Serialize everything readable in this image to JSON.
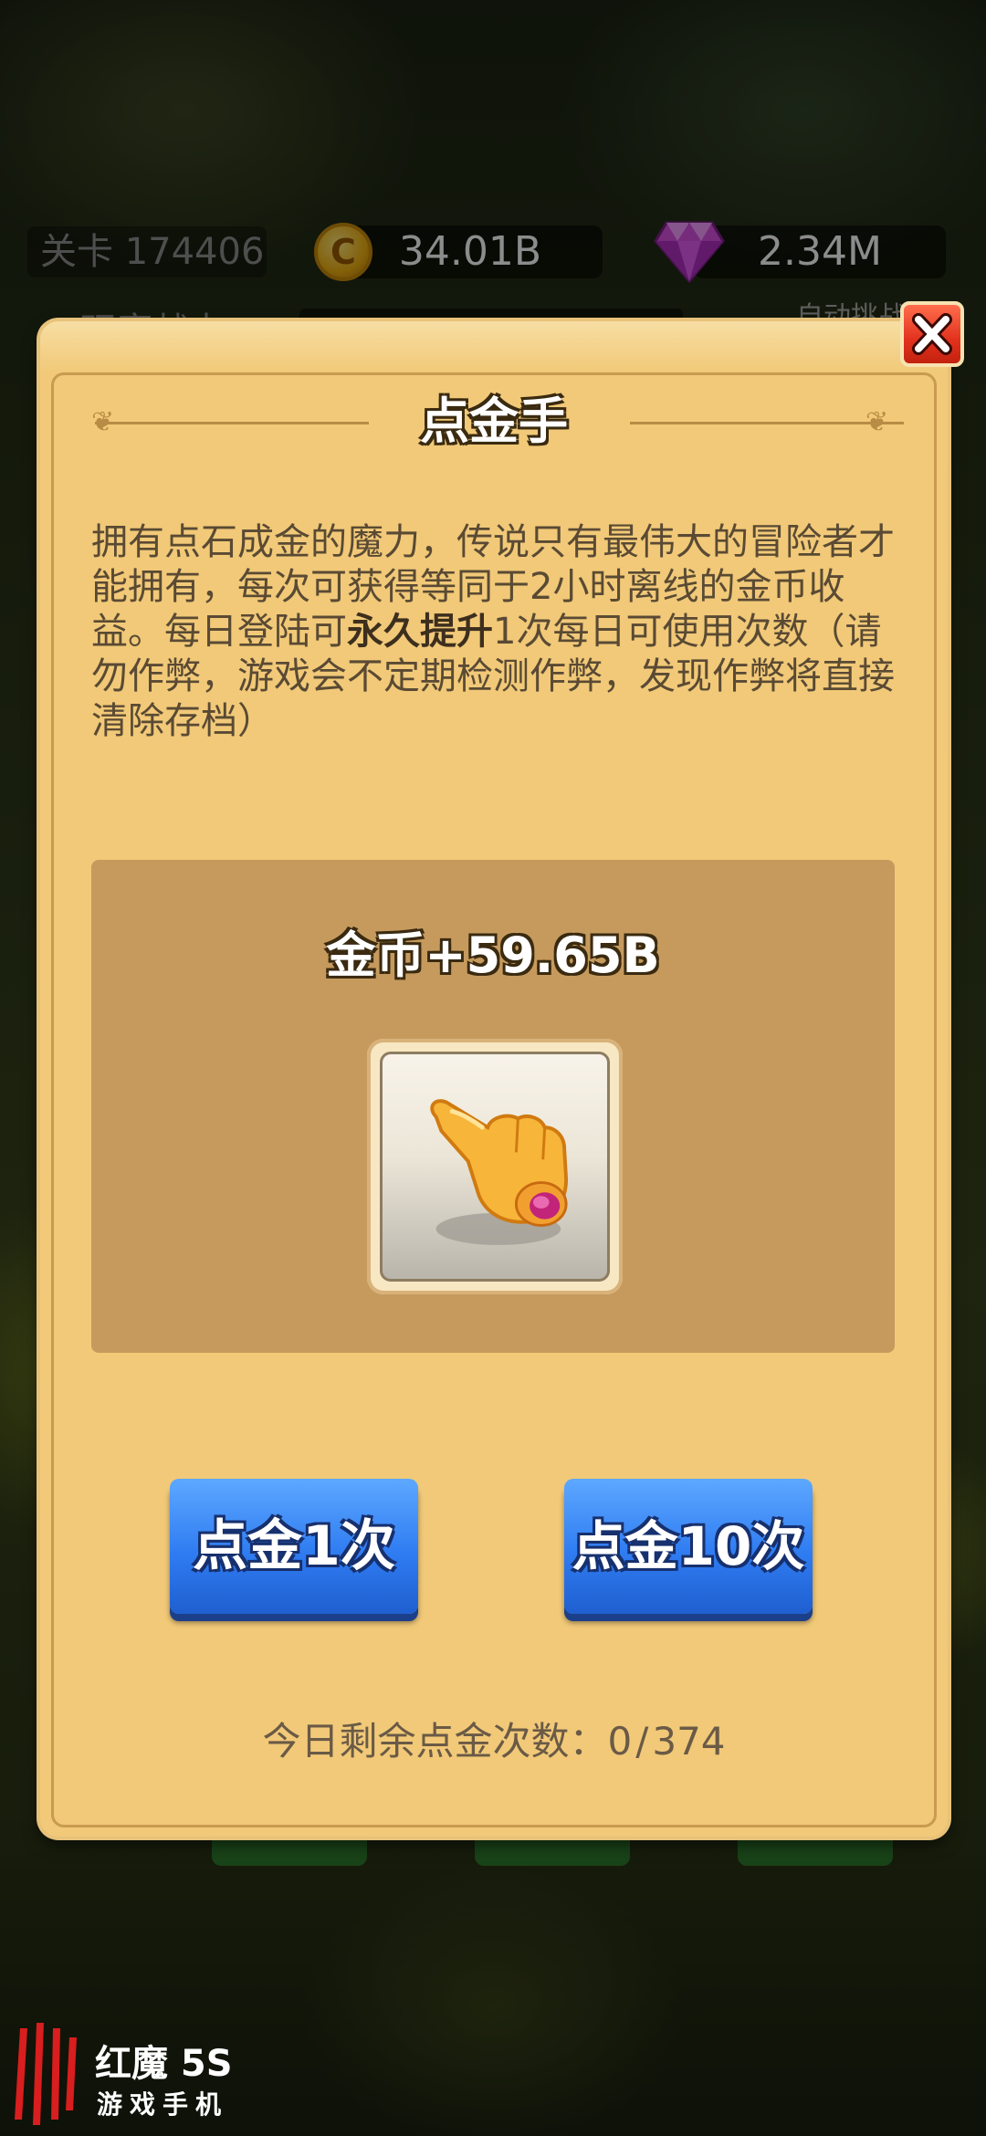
{
  "hud": {
    "stage_label": "关卡 174406",
    "coins": "34.01B",
    "gems": "2.34M",
    "power_label": "玩家战力",
    "auto_label": "自动挑战"
  },
  "dialog": {
    "title": "点金手",
    "description_part1": "拥有点石成金的魔力，传说只有最伟大的冒险者才能拥有，每次可获得等同于2小时离线的金币收益。每日登陆可",
    "description_bold": "永久提升",
    "description_part2": "1次每日可使用次数（请勿作弊，游戏会不定期检测作弊，发现作弊将直接清除存档）",
    "reward_text": "金币+59.65B",
    "button_once": "点金1次",
    "button_ten": "点金10次",
    "remaining_label": "今日剩余点金次数：",
    "remaining_used": "0",
    "remaining_total": "374"
  },
  "watermark": {
    "brand_line1": "红魔 5S",
    "brand_line2": "游戏手机"
  },
  "colors": {
    "dialog_bg": "#f1c978",
    "panel_bg": "#c69a5d",
    "button_blue": "#2f7cf2",
    "close_red": "#e2311d"
  },
  "icons": {
    "coin": "coin-icon",
    "gem": "diamond-icon",
    "close": "close-icon",
    "hand": "golden-finger-icon",
    "logo": "red-magic-logo-icon"
  }
}
